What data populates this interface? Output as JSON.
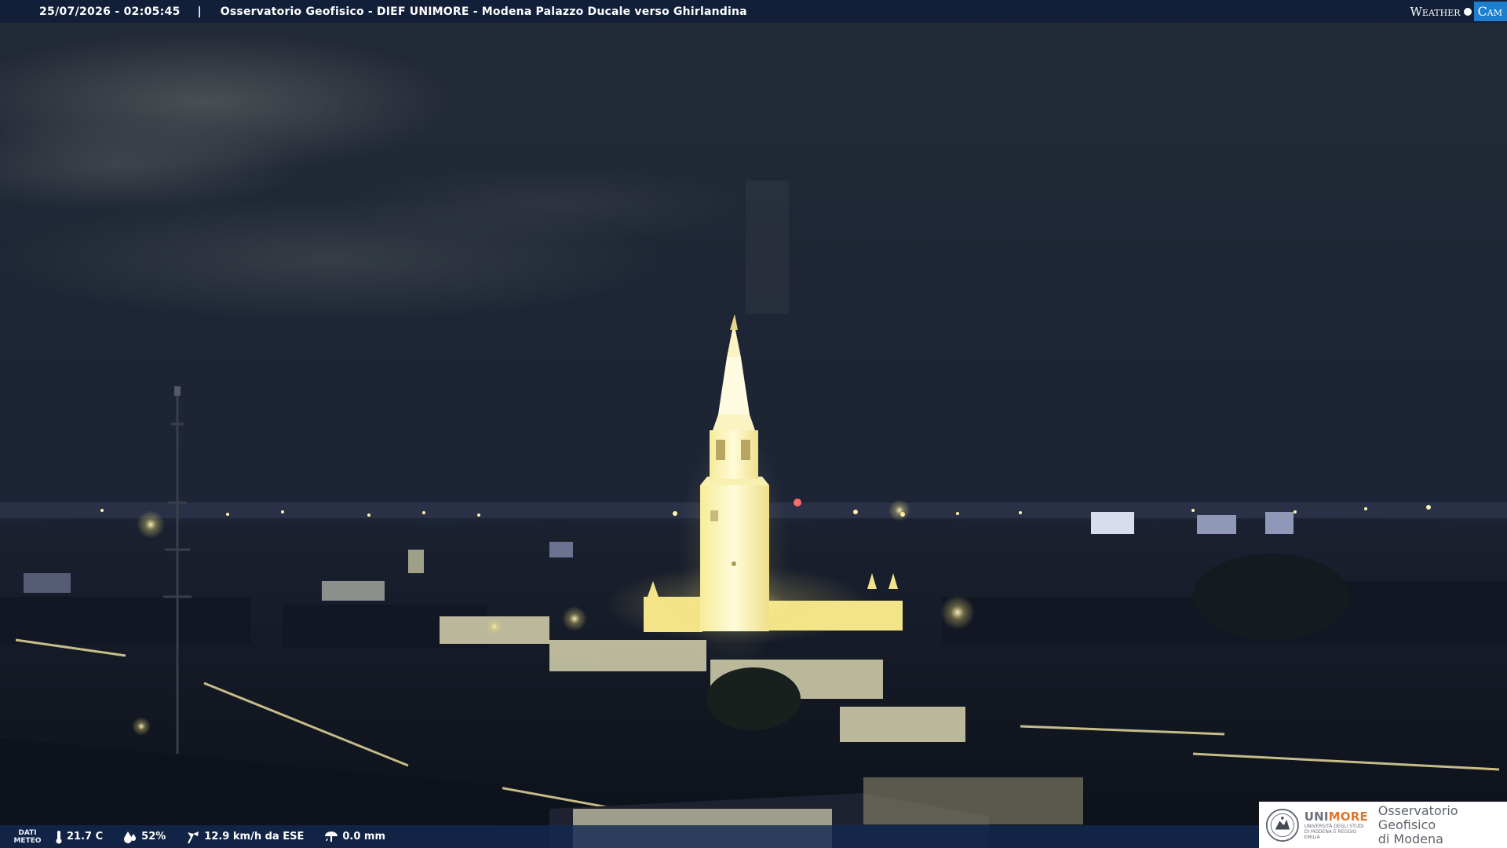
{
  "header": {
    "timestamp": "25/07/2026 - 02:05:45",
    "separator": "|",
    "title": "Osservatorio Geofisico - DIEF UNIMORE - Modena Palazzo Ducale verso Ghirlandina"
  },
  "brand": {
    "weather": "Weather",
    "cam": "Cam",
    "accent_color": "#1d7fd0"
  },
  "meteo": {
    "label_line1": "DATI",
    "label_line2": "METEO",
    "temperature": "21.7 C",
    "humidity": "52%",
    "wind": "12.9 km/h da ESE",
    "rain": "0.0 mm",
    "icons": [
      "thermometer-icon",
      "humidity-drop-icon",
      "wind-icon",
      "rain-gauge-icon"
    ]
  },
  "logo": {
    "uni_part1": "UNI",
    "uni_part2": "MORE",
    "uni_subtitle": "UNIVERSITÀ DEGLI STUDI DI MODENA E REGGIO EMILIA",
    "observatory_line1": "Osservatorio Geofisico",
    "observatory_line2": "di Modena",
    "accent_color": "#e3762a"
  }
}
